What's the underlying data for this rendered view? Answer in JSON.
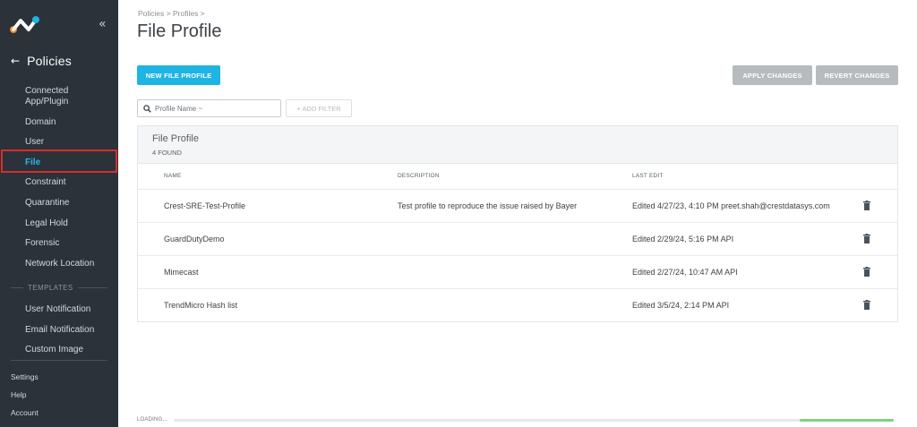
{
  "sidebar": {
    "collapse_glyph": "«",
    "back_glyph": "←",
    "section_title": "Policies",
    "items": [
      {
        "label": "Connected App/Plugin",
        "active": false
      },
      {
        "label": "Domain",
        "active": false
      },
      {
        "label": "User",
        "active": false
      },
      {
        "label": "File",
        "active": true
      },
      {
        "label": "Constraint",
        "active": false
      },
      {
        "label": "Quarantine",
        "active": false
      },
      {
        "label": "Legal Hold",
        "active": false
      },
      {
        "label": "Forensic",
        "active": false
      },
      {
        "label": "Network Location",
        "active": false
      }
    ],
    "templates_label": "TEMPLATES",
    "template_items": [
      {
        "label": "User Notification"
      },
      {
        "label": "Email Notification"
      },
      {
        "label": "Custom Image"
      }
    ],
    "bottom_items": [
      {
        "label": "Settings"
      },
      {
        "label": "Help"
      },
      {
        "label": "Account"
      }
    ]
  },
  "main": {
    "breadcrumb": "Policies > Profiles >",
    "title": "File Profile",
    "new_button": "NEW FILE PROFILE",
    "apply_button": "APPLY CHANGES",
    "revert_button": "REVERT CHANGES",
    "search_placeholder": "Profile Name ~",
    "add_filter": "+ ADD FILTER",
    "panel": {
      "title": "File Profile",
      "count": "4 FOUND",
      "columns": {
        "name": "NAME",
        "description": "DESCRIPTION",
        "last_edit": "LAST EDIT"
      },
      "rows": [
        {
          "name": "Crest-SRE-Test-Profile",
          "description": "Test profile to reproduce the issue raised by Bayer",
          "last_edit": "Edited 4/27/23, 4:10 PM preet.shah@crestdatasys.com"
        },
        {
          "name": "GuardDutyDemo",
          "description": "",
          "last_edit": "Edited 2/29/24, 5:16 PM API"
        },
        {
          "name": "Mimecast",
          "description": "",
          "last_edit": "Edited 2/27/24, 10:47 AM API"
        },
        {
          "name": "TrendMicro Hash list",
          "description": "",
          "last_edit": "Edited 3/5/24, 2:14 PM API"
        }
      ]
    },
    "loading_label": "LOADING...",
    "loading_progress_start": 0.87,
    "loading_progress_end": 1.0
  },
  "icons": {
    "logo": "netskope-logo-icon",
    "collapse": "double-chevron-left-icon",
    "back": "arrow-left-icon",
    "search": "search-icon",
    "trash": "trash-icon"
  },
  "colors": {
    "sidebar_bg": "#2b3239",
    "accent": "#1eb4e4",
    "active_outline": "#d32f2f",
    "disabled_button": "#b7bbbe",
    "progress": "#7ed47f"
  }
}
